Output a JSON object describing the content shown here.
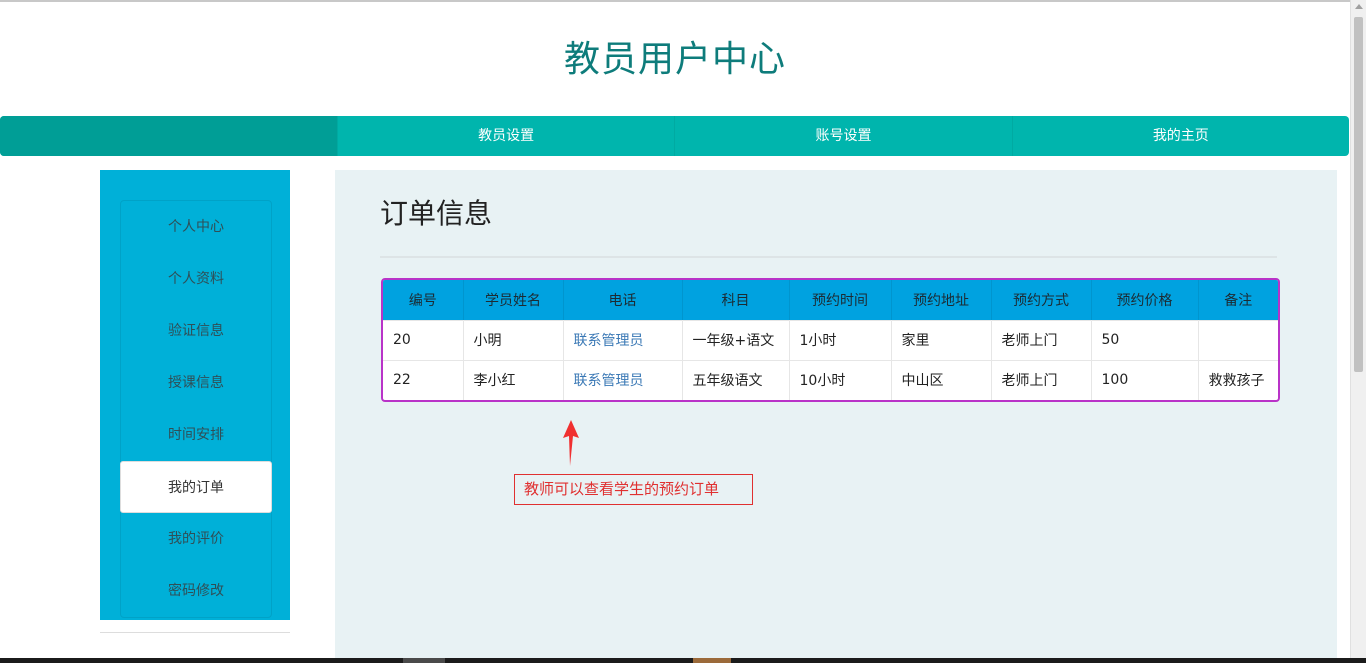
{
  "header": {
    "title": "教员用户中心"
  },
  "navbar": {
    "items": [
      {
        "label": "教员设置"
      },
      {
        "label": "账号设置"
      },
      {
        "label": "我的主页"
      }
    ]
  },
  "sidebar": {
    "items": [
      {
        "label": "个人中心"
      },
      {
        "label": "个人资料"
      },
      {
        "label": "验证信息"
      },
      {
        "label": "授课信息"
      },
      {
        "label": "时间安排"
      },
      {
        "label": "我的订单",
        "active": true
      },
      {
        "label": "我的评价"
      },
      {
        "label": "密码修改"
      }
    ]
  },
  "main": {
    "title": "订单信息",
    "table": {
      "headers": [
        "编号",
        "学员姓名",
        "电话",
        "科目",
        "预约时间",
        "预约地址",
        "预约方式",
        "预约价格",
        "备注"
      ],
      "rows": [
        [
          "20",
          "小明",
          "联系管理员",
          "一年级+语文",
          "1小时",
          "家里",
          "老师上门",
          "50",
          ""
        ],
        [
          "22",
          "李小红",
          "联系管理员",
          "五年级语文",
          "10小时",
          "中山区",
          "老师上门",
          "100",
          "救救孩子"
        ]
      ]
    },
    "annotation": "教师可以查看学生的预约订单"
  },
  "colors": {
    "title": "#0e7c7b",
    "navbar": "#00b5ad",
    "sidebar": "#00b0d8",
    "table_header": "#00a2e0",
    "table_border": "#b933c8",
    "annotation": "#e03030"
  }
}
